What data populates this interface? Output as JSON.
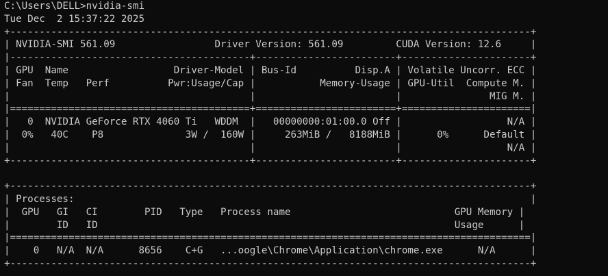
{
  "terminal": {
    "background": "#0c0c0c",
    "foreground": "#cccccc",
    "lines": [
      "C:\\Users\\DELL>nvidia-smi",
      "Tue Dec  2 15:37:22 2025",
      "+-----------------------------------------------------------------------------------------+",
      "| NVIDIA-SMI 561.09                 Driver Version: 561.09         CUDA Version: 12.6     |",
      "|-----------------------------------------+------------------------+----------------------+",
      "| GPU  Name                  Driver-Model | Bus-Id          Disp.A | Volatile Uncorr. ECC |",
      "| Fan  Temp   Perf          Pwr:Usage/Cap |           Memory-Usage | GPU-Util  Compute M. |",
      "|                                         |                        |               MIG M. |",
      "|=========================================+========================+======================|",
      "|   0  NVIDIA GeForce RTX 4060 Ti   WDDM  |   00000000:01:00.0 Off |                  N/A |",
      "|  0%   40C    P8              3W /  160W |     263MiB /   8188MiB |      0%      Default |",
      "|                                         |                        |                  N/A |",
      "+-----------------------------------------+------------------------+----------------------+",
      "",
      "+-----------------------------------------------------------------------------------------+",
      "| Processes:                                                                              |",
      "|  GPU   GI   CI        PID   Type   Process name                            GPU Memory |",
      "|        ID   ID                                                             Usage      |",
      "|=========================================================================================|",
      "|    0   N/A  N/A      8656    C+G   ...oogle\\Chrome\\Application\\chrome.exe      N/A      |",
      "+-----------------------------------------------------------------------------------------+"
    ]
  }
}
